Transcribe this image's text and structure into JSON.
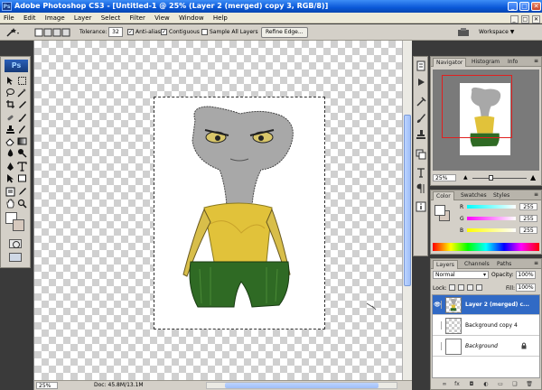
{
  "window": {
    "title": "Adobe Photoshop CS3 - [Untitled-1 @ 25% (Layer 2 (merged) copy 3, RGB/8)]",
    "app_icon_label": "Ps",
    "minimize": "_",
    "maximize": "□",
    "close": "✕"
  },
  "menu": [
    "File",
    "Edit",
    "Image",
    "Layer",
    "Select",
    "Filter",
    "View",
    "Window",
    "Help"
  ],
  "doc_controls": [
    "_",
    "□",
    "✕"
  ],
  "options": {
    "tolerance_label": "Tolerance:",
    "tolerance_value": "32",
    "anti_alias_label": "Anti-alias",
    "anti_alias_checked": true,
    "contiguous_label": "Contiguous",
    "contiguous_checked": true,
    "sample_all_label": "Sample All Layers",
    "sample_all_checked": false,
    "refine_edge_label": "Refine Edge...",
    "workspace_label": "Workspace ▼"
  },
  "tools": {
    "logo": "Ps"
  },
  "document": {
    "zoom": "25%",
    "doc_info": "Doc: 45.8M/13.1M"
  },
  "navigator": {
    "tabs": [
      "Navigator",
      "Histogram",
      "Info"
    ],
    "active_tab": "Navigator",
    "zoom": "25%"
  },
  "color": {
    "tabs": [
      "Color",
      "Swatches",
      "Styles"
    ],
    "active_tab": "Color",
    "r_label": "R",
    "g_label": "G",
    "b_label": "B",
    "r": "255",
    "g": "255",
    "b": "255"
  },
  "layers": {
    "tabs": [
      "Layers",
      "Channels",
      "Paths"
    ],
    "active_tab": "Layers",
    "blend_mode": "Normal",
    "opacity_label": "Opacity:",
    "opacity": "100%",
    "lock_label": "Lock:",
    "fill_label": "Fill:",
    "fill": "100%",
    "items": [
      {
        "name": "Layer 2 (merged) c...",
        "visible": true,
        "selected": true
      },
      {
        "name": "Background copy 4",
        "visible": false,
        "selected": false
      },
      {
        "name": "Background",
        "visible": false,
        "selected": false,
        "locked": true
      }
    ],
    "footer_icons": [
      "link-icon",
      "fx-icon",
      "mask-icon",
      "adjustment-icon",
      "group-icon",
      "new-layer-icon",
      "trash-icon"
    ]
  },
  "colors": {
    "accent": "#316ac5",
    "titlebar": "#0a58d8",
    "background_swatch": "#d6c8bd"
  }
}
